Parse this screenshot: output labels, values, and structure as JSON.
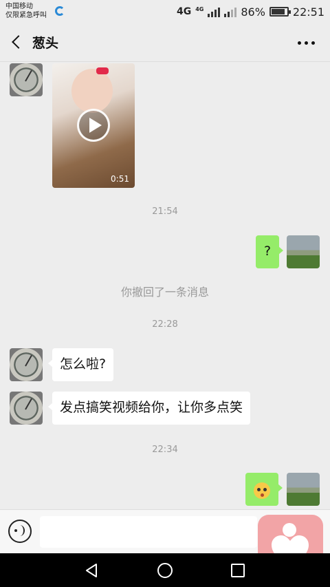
{
  "status_bar": {
    "carrier_line1": "中国移动",
    "carrier_line2": "仅限紧急呼叫",
    "network": "4G",
    "network_small": "4G",
    "battery_percent": "86%",
    "battery_level": 0.86,
    "time": "22:51"
  },
  "header": {
    "title": "葱头"
  },
  "video": {
    "duration": "0:51"
  },
  "messages": {
    "time1": "21:54",
    "question_mark": "?",
    "recall_notice": "你撤回了一条消息",
    "time2": "22:28",
    "msg_1": "怎么啦?",
    "msg_2": "发点搞笑视频给你，让你多点笑",
    "time3": "22:34"
  },
  "input": {
    "placeholder": ""
  }
}
